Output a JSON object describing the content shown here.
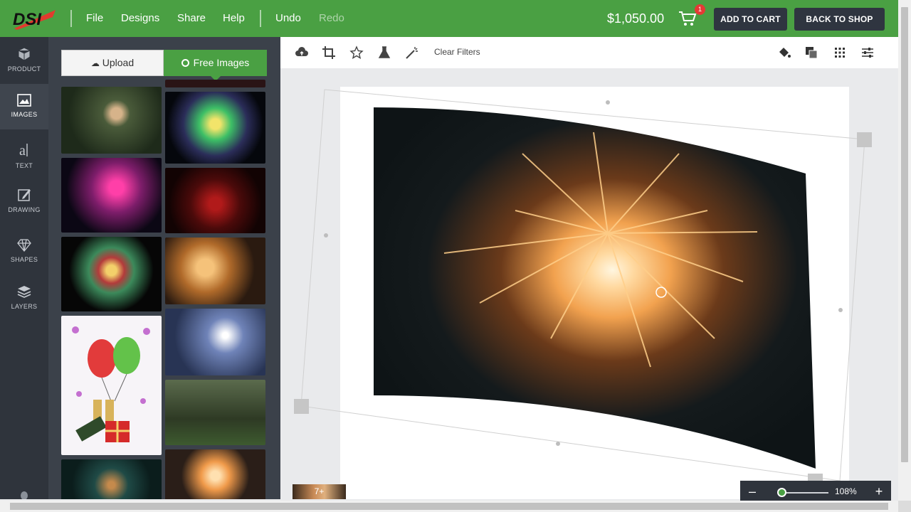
{
  "header": {
    "logo_text": "DSI",
    "menu": [
      "File",
      "Designs",
      "Share",
      "Help"
    ],
    "undo": "Undo",
    "redo": "Redo",
    "price": "$1,050.00",
    "cart_count": "1",
    "add_to_cart": "ADD TO CART",
    "back_to_shop": "BACK TO SHOP"
  },
  "sidebar": {
    "items": [
      {
        "label": "PRODUCT",
        "icon": "cube-icon"
      },
      {
        "label": "IMAGES",
        "icon": "image-icon"
      },
      {
        "label": "TEXT",
        "icon": "text-icon"
      },
      {
        "label": "DRAWING",
        "icon": "pencil-icon"
      },
      {
        "label": "SHAPES",
        "icon": "diamond-icon"
      },
      {
        "label": "LAYERS",
        "icon": "layers-icon"
      }
    ]
  },
  "panel": {
    "upload_label": "Upload",
    "free_images_label": "Free Images"
  },
  "toolbar": {
    "clear_filters": "Clear Filters"
  },
  "canvas": {
    "more_label": "7+"
  },
  "zoom": {
    "value": "108%",
    "minus": "–",
    "plus": "+"
  },
  "colors": {
    "brand_green": "#4aa043",
    "dark": "#2f343c"
  }
}
